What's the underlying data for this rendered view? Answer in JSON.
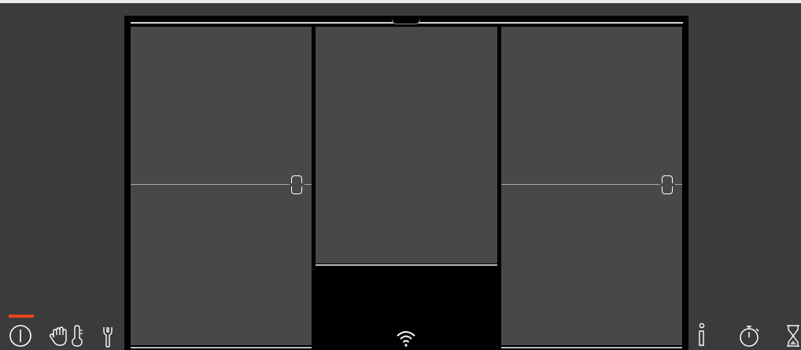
{
  "screen": {
    "title": "",
    "colors": {
      "background": "#3b3b3b",
      "frame": "#000000",
      "pane": "#484848",
      "icon": "#ffffff",
      "power_indicator": "#e9451c"
    }
  },
  "appliance": {
    "panes": [
      {
        "id": "left",
        "has_handle": true
      },
      {
        "id": "center",
        "has_handle": false
      },
      {
        "id": "right",
        "has_handle": true
      }
    ]
  },
  "status_bar": {
    "left_icons": [
      "power-icon",
      "manual-mode-icon",
      "temperature-icon",
      "service-wrench-icon"
    ],
    "center_icons": [
      "wifi-icon"
    ],
    "right_icons": [
      "info-icon",
      "timer-icon",
      "hourglass-icon"
    ],
    "power_indicator_active": true
  }
}
